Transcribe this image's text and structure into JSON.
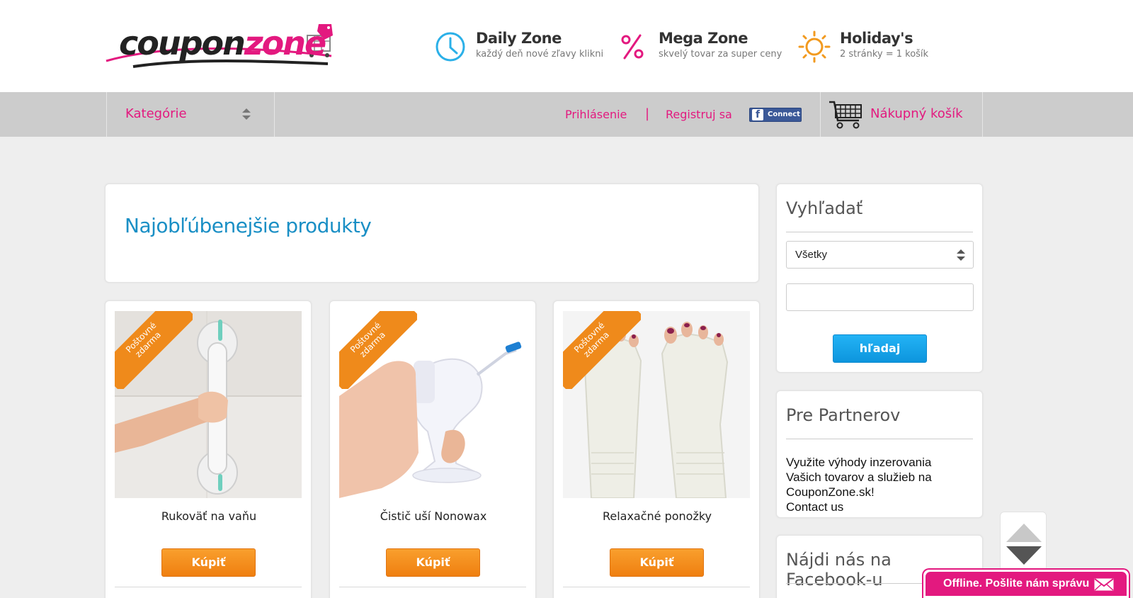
{
  "header": {
    "logo_text_a": "coupon",
    "logo_text_b": "zone",
    "zones": [
      {
        "title": "Daily Zone",
        "subtitle": "každý deň nové zľavy klikni",
        "icon": "clock-icon"
      },
      {
        "title": "Mega Zone",
        "subtitle": "skvelý tovar za super ceny",
        "icon": "percent-icon"
      },
      {
        "title": "Holiday's",
        "subtitle": "2 stránky = 1 košík",
        "icon": "sun-icon"
      }
    ]
  },
  "nav": {
    "categories_label": "Kategórie",
    "login_label": "Prihlásenie",
    "separator": "|",
    "register_label": "Registruj sa",
    "fb_connect_label": "Connect",
    "fb_letter": "f",
    "cart_label": "Nákupný košík"
  },
  "main": {
    "title": "Najobľúbenejšie produkty",
    "products": [
      {
        "name": "Rukoväť na vaňu",
        "ribbon_line1": "Poštovné",
        "ribbon_line2": "zdarma",
        "buy_label": "Kúpiť"
      },
      {
        "name": "Čistič uší Nonowax",
        "ribbon_line1": "Poštovné",
        "ribbon_line2": "zdarma",
        "buy_label": "Kúpiť"
      },
      {
        "name": "Relaxačné ponožky",
        "ribbon_line1": "Poštovné",
        "ribbon_line2": "zdarma",
        "buy_label": "Kúpiť"
      }
    ]
  },
  "sidebar": {
    "search": {
      "title": "Vyhľadať",
      "select_value": "Všetky",
      "input_value": "",
      "button_label": "hľadaj"
    },
    "partners": {
      "title": "Pre Partnerov",
      "lines": [
        "Využite výhody inzerovania",
        "Vašich tovarov a služieb na",
        "CouponZone.sk!",
        "Contact us"
      ]
    },
    "facebook": {
      "title": "Nájdi nás na Facebook-u"
    }
  },
  "chat": {
    "label": "Offline. Pošlite nám správu"
  },
  "colors": {
    "accent_pink": "#e3197f",
    "title_blue": "#1a8fc5",
    "buy_orange": "#f5901f",
    "search_blue": "#16a4ea",
    "nav_gray": "#cccccc",
    "page_bg": "#eeeeee"
  }
}
